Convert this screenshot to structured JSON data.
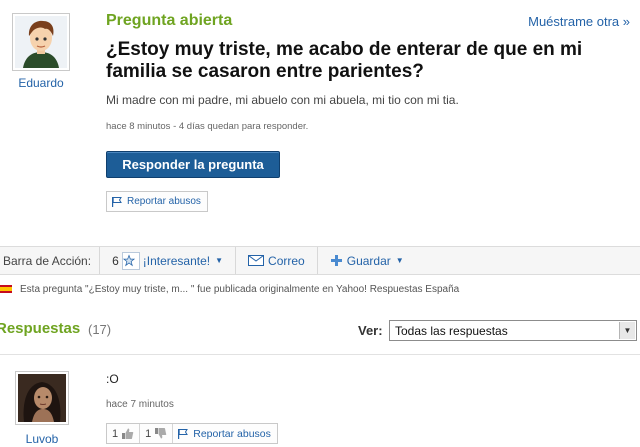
{
  "question": {
    "asker_name": "Eduardo",
    "status": "Pregunta abierta",
    "show_other_link": "Muéstrame otra »",
    "title": "¿Estoy muy triste, me acabo de enterar de que en mi familia se casaron entre parientes?",
    "detail": "Mi madre con mi padre, mi abuelo con mi abuela, mi tio con mi tia.",
    "meta": "hace 8 minutos - 4 días quedan para responder.",
    "answer_button_label": "Responder la pregunta",
    "report_label": "Reportar abusos"
  },
  "action_bar": {
    "label": "Barra de Acción:",
    "interesting_count": "6",
    "interesting_label": "¡Interesante!",
    "email_label": "Correo",
    "save_label": "Guardar"
  },
  "origin_note": "Esta pregunta \"¿Estoy muy triste, m... \" fue publicada originalmente en Yahoo! Respuestas España",
  "answers": {
    "title": "Respuestas",
    "count": "(17)",
    "filter_label": "Ver:",
    "filter_value": "Todas las respuestas",
    "items": [
      {
        "user": "Luvob",
        "text": ":O",
        "time": "hace 7 minutos",
        "thumbs_up": "1",
        "thumbs_down": "1",
        "report_label": "Reportar abusos"
      }
    ]
  },
  "colors": {
    "accent_green": "#6fa421",
    "link_blue": "#2463a8",
    "button_blue": "#1d5d97"
  },
  "icons": [
    "user-avatar",
    "flag-icon",
    "star-icon",
    "email-icon",
    "plus-icon",
    "chevron-down-icon",
    "thumbs-up-icon",
    "thumbs-down-icon",
    "spain-flag-icon"
  ]
}
